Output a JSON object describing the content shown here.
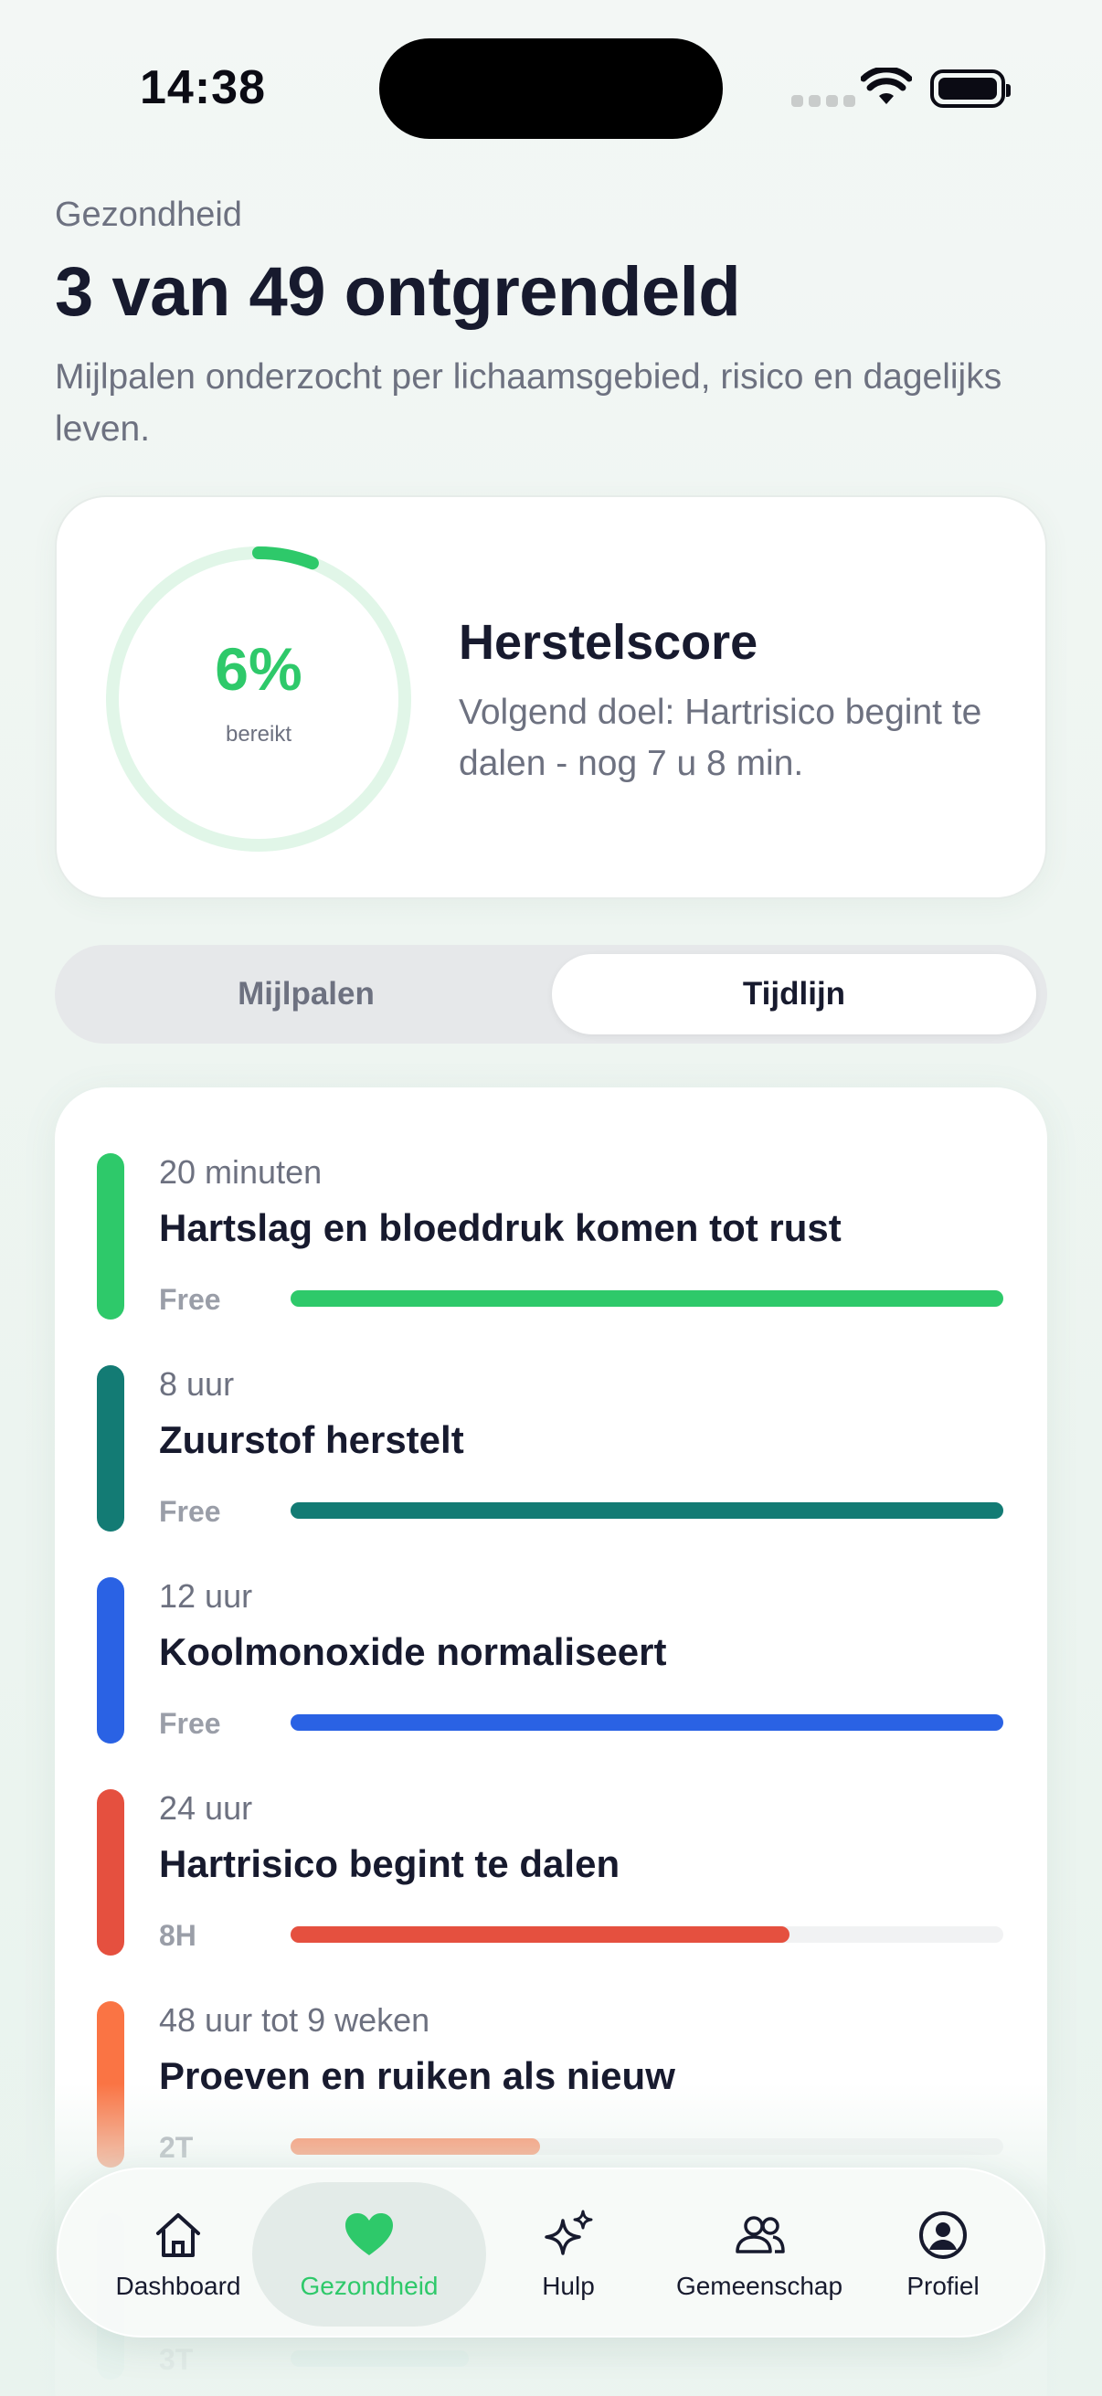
{
  "status_bar": {
    "time": "14:38"
  },
  "header": {
    "overline": "Gezondheid",
    "title": "3 van 49 ontgrendeld",
    "subtitle": "Mijlpalen onderzocht per lichaamsgebied, risico en dagelijks leven."
  },
  "score_card": {
    "progress_percent": 6,
    "value_text": "6%",
    "value_label": "bereikt",
    "title": "Herstelscore",
    "description": "Volgend doel: Hartrisico begint te dalen - nog 7 u 8 min."
  },
  "segment": {
    "options": [
      "Mijlpalen",
      "Tijdlijn"
    ],
    "selected": "Tijdlijn"
  },
  "timeline": [
    {
      "period": "20 minuten",
      "label": "Hartslag en bloeddruk komen tot rust",
      "status": "Free",
      "progress": 1.0,
      "color": "#2ec96a"
    },
    {
      "period": "8 uur",
      "label": "Zuurstof herstelt",
      "status": "Free",
      "progress": 1.0,
      "color": "#137b74"
    },
    {
      "period": "12 uur",
      "label": "Koolmonoxide normaliseert",
      "status": "Free",
      "progress": 1.0,
      "color": "#2a62e4"
    },
    {
      "period": "24 uur",
      "label": "Hartrisico begint te dalen",
      "status": "8H",
      "progress": 0.7,
      "color": "#e5503f"
    },
    {
      "period": "48 uur tot 9 weken",
      "label": "Proeven en ruiken als nieuw",
      "status": "2T",
      "progress": 0.35,
      "color": "#fa7444"
    },
    {
      "period": "",
      "label": "",
      "status": "3T",
      "progress": 0.25,
      "color": "#5cc2bf"
    }
  ],
  "tab_bar": {
    "tabs": [
      {
        "label": "Dashboard",
        "icon": "home-icon"
      },
      {
        "label": "Gezondheid",
        "icon": "heart-icon"
      },
      {
        "label": "Hulp",
        "icon": "sparkles-icon"
      },
      {
        "label": "Gemeenschap",
        "icon": "people-icon"
      },
      {
        "label": "Profiel",
        "icon": "profile-icon"
      }
    ],
    "active": "Gezondheid"
  },
  "colors": {
    "accent": "#2ec96a",
    "title": "#171a2e",
    "muted": "#6d7180"
  }
}
